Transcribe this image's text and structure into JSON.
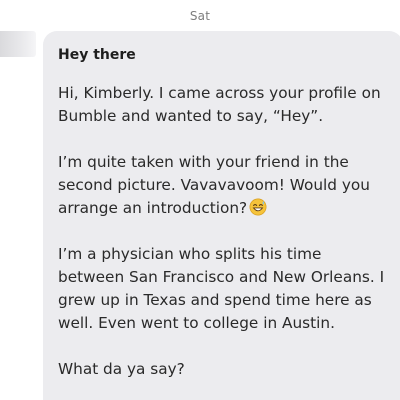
{
  "thread": {
    "day_label": "Sat"
  },
  "message": {
    "subject": "Hey there",
    "paragraphs": [
      "Hi, Kimberly. I came across your profile on\nBumble and wanted to say, “Hey”.",
      "I’m quite taken with your friend in the\nsecond picture. Vavavavoom! Would you\narrange an introduction?",
      "I’m a physician who splits his time\nbetween San Francisco and New Orleans. I\ngrew up in Texas and spend time here as\nwell. Even went to college in Austin.",
      "What da ya say?"
    ],
    "emoji": "grinning-face-with-sweat-icon"
  },
  "colors": {
    "bubble_bg": "#ececef",
    "text": "#2a2a2a",
    "timestamp": "#7d7d7d",
    "emoji_face": "#f5c33b"
  }
}
